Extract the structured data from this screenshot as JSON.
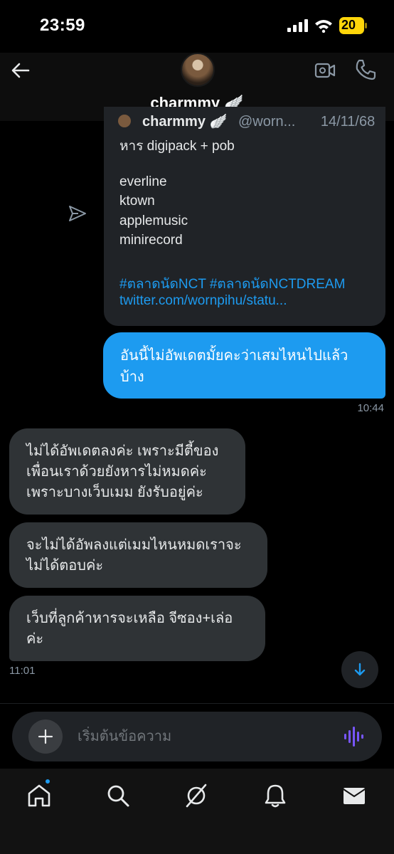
{
  "status_bar": {
    "time": "23:59",
    "battery": "20"
  },
  "header": {
    "contact_name": "charmmy 🪽"
  },
  "shared_post": {
    "author_name": "charmmy 🪽",
    "author_handle": "@worn...",
    "date": "14/11/68",
    "lines": [
      "หาร digipack + pob",
      "everline",
      "ktown",
      "applemusic",
      "minirecord"
    ],
    "hashtags": "#ตลาดนัดNCT #ตลาดนัดNCTDREAM",
    "link": "twitter.com/wornpihu/statu..."
  },
  "messages": {
    "outgoing": {
      "text": "อันนี้ไม่อัพเดตมั้ยคะว่าเสมไหนไปแล้วบ้าง",
      "time": "10:44"
    },
    "incoming": [
      {
        "text": "ไม่ได้อัพเดตลงค่ะ เพราะมีตี้ของเพื่อนเราด้วยยังหารไม่หมดค่ะ เพราะบางเว็บเมม ยังรับอยู่ค่ะ"
      },
      {
        "text": "จะไม่ได้อัพลงแต่เมมไหนหมดเราจะไม่ได้ตอบค่ะ"
      },
      {
        "text": "เว็บที่ลูกค้าหารจะเหลือ จีซอง+เล่อค่ะ"
      }
    ],
    "incoming_time": "11:01"
  },
  "composer": {
    "placeholder": "เริ่มต้นข้อความ"
  },
  "colors": {
    "accent": "#1d9bf0",
    "bubble_in": "#2f3336",
    "card": "#202327",
    "voice": "#7856ff"
  }
}
